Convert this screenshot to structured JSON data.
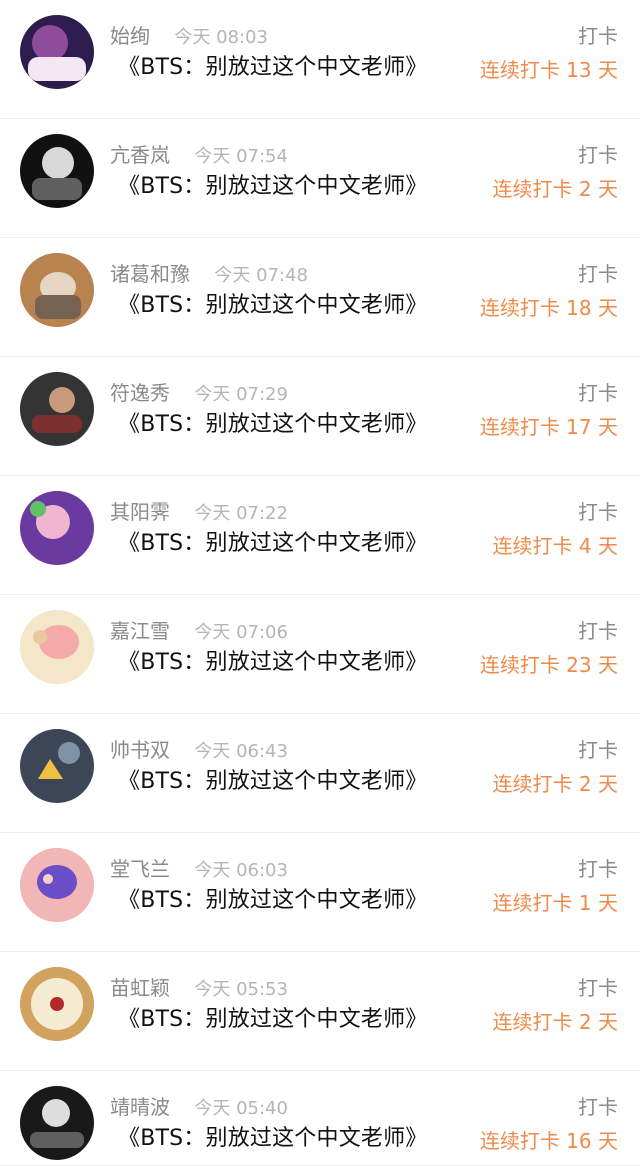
{
  "feed": {
    "items": [
      {
        "name": "始绚",
        "time": "今天 08:03",
        "title": "《BTS：别放过这个中文老师》",
        "action": "打卡",
        "streak": "连续打卡 13 天",
        "avatar_colors": [
          "#2d1c4d",
          "#8f4c9c",
          "#f2e7f2"
        ]
      },
      {
        "name": "亢香岚",
        "time": "今天 07:54",
        "title": "《BTS：别放过这个中文老师》",
        "action": "打卡",
        "streak": "连续打卡 2 天",
        "avatar_colors": [
          "#111111",
          "#d8d8d8",
          "#5f5f5f"
        ]
      },
      {
        "name": "诸葛和豫",
        "time": "今天 07:48",
        "title": "《BTS：别放过这个中文老师》",
        "action": "打卡",
        "streak": "连续打卡 18 天",
        "avatar_colors": [
          "#b8834f",
          "#e5d6c4",
          "#766250"
        ]
      },
      {
        "name": "符逸秀",
        "time": "今天 07:29",
        "title": "《BTS：别放过这个中文老师》",
        "action": "打卡",
        "streak": "连续打卡 17 天",
        "avatar_colors": [
          "#343434",
          "#c69a7a",
          "#7c2f2f"
        ]
      },
      {
        "name": "其阳霁",
        "time": "今天 07:22",
        "title": "《BTS：别放过这个中文老师》",
        "action": "打卡",
        "streak": "连续打卡 4 天",
        "avatar_colors": [
          "#6b3aa0",
          "#f0b6d0",
          "#64c067"
        ]
      },
      {
        "name": "嘉江雪",
        "time": "今天 07:06",
        "title": "《BTS：别放过这个中文老师》",
        "action": "打卡",
        "streak": "连续打卡 23 天",
        "avatar_colors": [
          "#f4e6c8",
          "#f4aaa8",
          "#e8c99d"
        ]
      },
      {
        "name": "帅书双",
        "time": "今天 06:43",
        "title": "《BTS：别放过这个中文老师》",
        "action": "打卡",
        "streak": "连续打卡 2 天",
        "avatar_colors": [
          "#3d4657",
          "#f0c040",
          "#7f93a7"
        ]
      },
      {
        "name": "堂飞兰",
        "time": "今天 06:03",
        "title": "《BTS：别放过这个中文老师》",
        "action": "打卡",
        "streak": "连续打卡 1 天",
        "avatar_colors": [
          "#f3b6b7",
          "#6a4dc8",
          "#f6d0c3"
        ]
      },
      {
        "name": "苗虹颖",
        "time": "今天 05:53",
        "title": "《BTS：别放过这个中文老师》",
        "action": "打卡",
        "streak": "连续打卡 2 天",
        "avatar_colors": [
          "#d2a35f",
          "#f5ead2",
          "#b22929"
        ]
      },
      {
        "name": "靖晴波",
        "time": "今天 05:40",
        "title": "《BTS：别放过这个中文老师》",
        "action": "打卡",
        "streak": "连续打卡 16 天",
        "avatar_colors": [
          "#191919",
          "#dddddd",
          "#5f5f5f"
        ]
      }
    ]
  }
}
